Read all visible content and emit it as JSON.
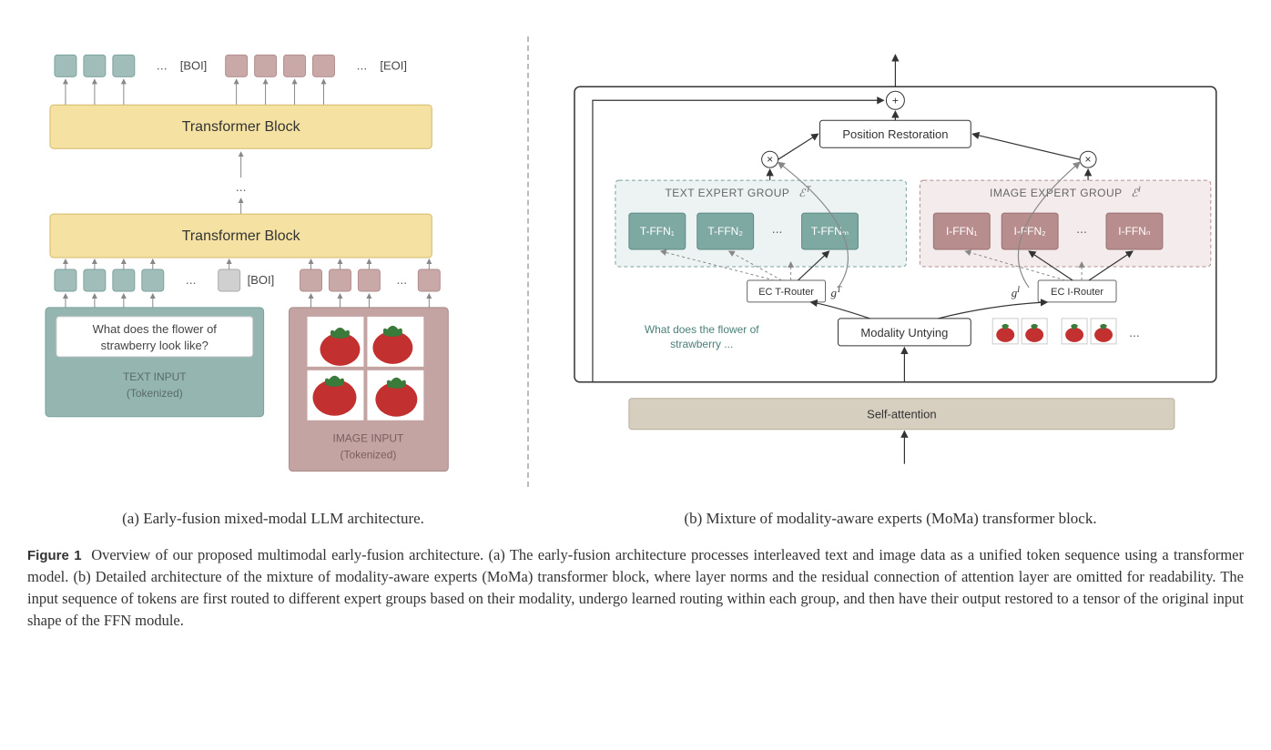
{
  "panel_a": {
    "top_tokens": {
      "boi": "[BOI]",
      "eoi": "[EOI]"
    },
    "transformer_block_label": "Transformer Block",
    "boi_mid": "[BOI]",
    "text_input": {
      "prompt_line1": "What does the flower of",
      "prompt_line2": "strawberry look like?",
      "label_line1": "TEXT INPUT",
      "label_line2": "(Tokenized)"
    },
    "image_input": {
      "label_line1": "IMAGE INPUT",
      "label_line2": "(Tokenized)"
    },
    "ellipsis": "..."
  },
  "panel_b": {
    "position_restoration": "Position Restoration",
    "text_group_title_a": "TEXT EXPERT GROUP",
    "text_group_title_b": "ℰ",
    "image_group_title_a": "IMAGE EXPERT GROUP",
    "image_group_title_b": "ℰ",
    "t_experts": [
      "T-FFN₁",
      "T-FFN₂",
      "T-FFNₘ"
    ],
    "i_experts": [
      "I-FFN₁",
      "I-FFN₂",
      "I-FFNₙ"
    ],
    "ec_t_router": "EC T-Router",
    "ec_i_router": "EC I-Router",
    "g_t": "g",
    "g_t_sup": "T",
    "g_i": "g",
    "g_i_sup": "I",
    "modality_untying": "Modality Untying",
    "self_attention": "Self-attention",
    "teal_line1": "What does the flower of",
    "teal_line2": "strawberry ...",
    "ellipsis": "..."
  },
  "subcaptions": {
    "a": "(a) Early-fusion mixed-modal LLM architecture.",
    "b": "(b) Mixture of modality-aware experts (MoMa) transformer block."
  },
  "caption": {
    "label": "Figure 1",
    "text": "Overview of our proposed multimodal early-fusion architecture. (a) The early-fusion architecture processes interleaved text and image data as a unified token sequence using a transformer model. (b) Detailed architecture of the mixture of modality-aware experts (MoMa) transformer block, where layer norms and the residual connection of attention layer are omitted for readability. The input sequence of tokens are first routed to different expert groups based on their modality, undergo learned routing within each group, and then have their output restored to a tensor of the original input shape of the FFN module."
  }
}
